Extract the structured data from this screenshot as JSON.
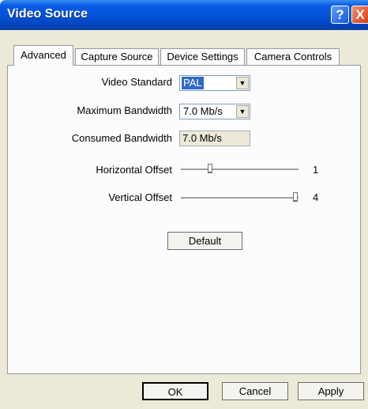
{
  "window": {
    "title": "Video Source"
  },
  "titlebar": {
    "help_glyph": "?",
    "close_glyph": "X"
  },
  "tabs": [
    {
      "label": "Advanced",
      "active": true
    },
    {
      "label": "Capture Source",
      "active": false
    },
    {
      "label": "Device Settings",
      "active": false
    },
    {
      "label": "Camera Controls",
      "active": false
    }
  ],
  "fields": {
    "video_standard": {
      "label": "Video Standard",
      "value": "PAL"
    },
    "max_bandwidth": {
      "label": "Maximum Bandwidth",
      "value": "7.0 Mb/s"
    },
    "consumed_bandwidth": {
      "label": "Consumed Bandwidth",
      "value": "7.0 Mb/s"
    }
  },
  "sliders": {
    "horizontal_offset": {
      "label": "Horizontal Offset",
      "value": "1",
      "position_fraction": 0.25
    },
    "vertical_offset": {
      "label": "Vertical Offset",
      "value": "4",
      "position_fraction": 1.0
    }
  },
  "buttons": {
    "default": "Default",
    "ok": "OK",
    "cancel": "Cancel",
    "apply": "Apply"
  },
  "colors": {
    "titlebar": "#0451d6",
    "dialog_bg": "#ece9d8",
    "selection": "#316ac5"
  }
}
